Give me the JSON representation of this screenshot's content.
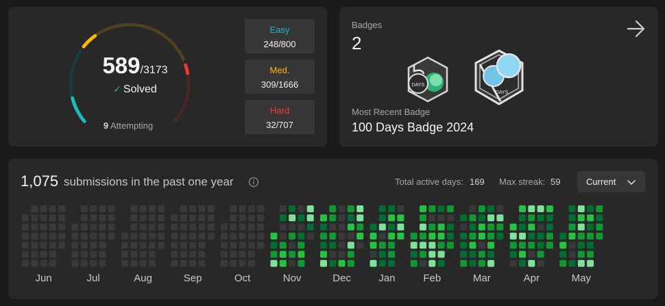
{
  "progress": {
    "solved": "589",
    "total": "/3173",
    "solved_label": "Solved",
    "attempting_count": "9",
    "attempting_label": "Attempting",
    "difficulties": [
      {
        "name": "Easy",
        "count": "248/800",
        "color": "#1cbaba"
      },
      {
        "name": "Med.",
        "count": "309/1666",
        "color": "#ffb700"
      },
      {
        "name": "Hard",
        "count": "32/707",
        "color": "#f63737"
      }
    ],
    "ring_fraction": {
      "easy": 0.31,
      "medium": 0.185,
      "hard": 0.045
    }
  },
  "badges": {
    "label": "Badges",
    "count": "2",
    "badge1_label": "DAYS",
    "badge2_label": "DAYS",
    "recent_label": "Most Recent Badge",
    "recent_name": "100 Days Badge 2024"
  },
  "heatmap": {
    "count": "1,075",
    "text": "submissions in the past one year",
    "active_days_label": "Total active days:",
    "active_days": "169",
    "max_streak_label": "Max streak:",
    "max_streak": "59",
    "select_value": "Current",
    "months": [
      "Jun",
      "Jul",
      "Aug",
      "Sep",
      "Oct",
      "Nov",
      "Dec",
      "Jan",
      "Feb",
      "Mar",
      "Apr",
      "May"
    ],
    "colors": {
      "empty": "#393939",
      "l1": "#006d32",
      "l2": "#109932",
      "l3": "#26c241",
      "l4": "#7ee29b"
    }
  }
}
